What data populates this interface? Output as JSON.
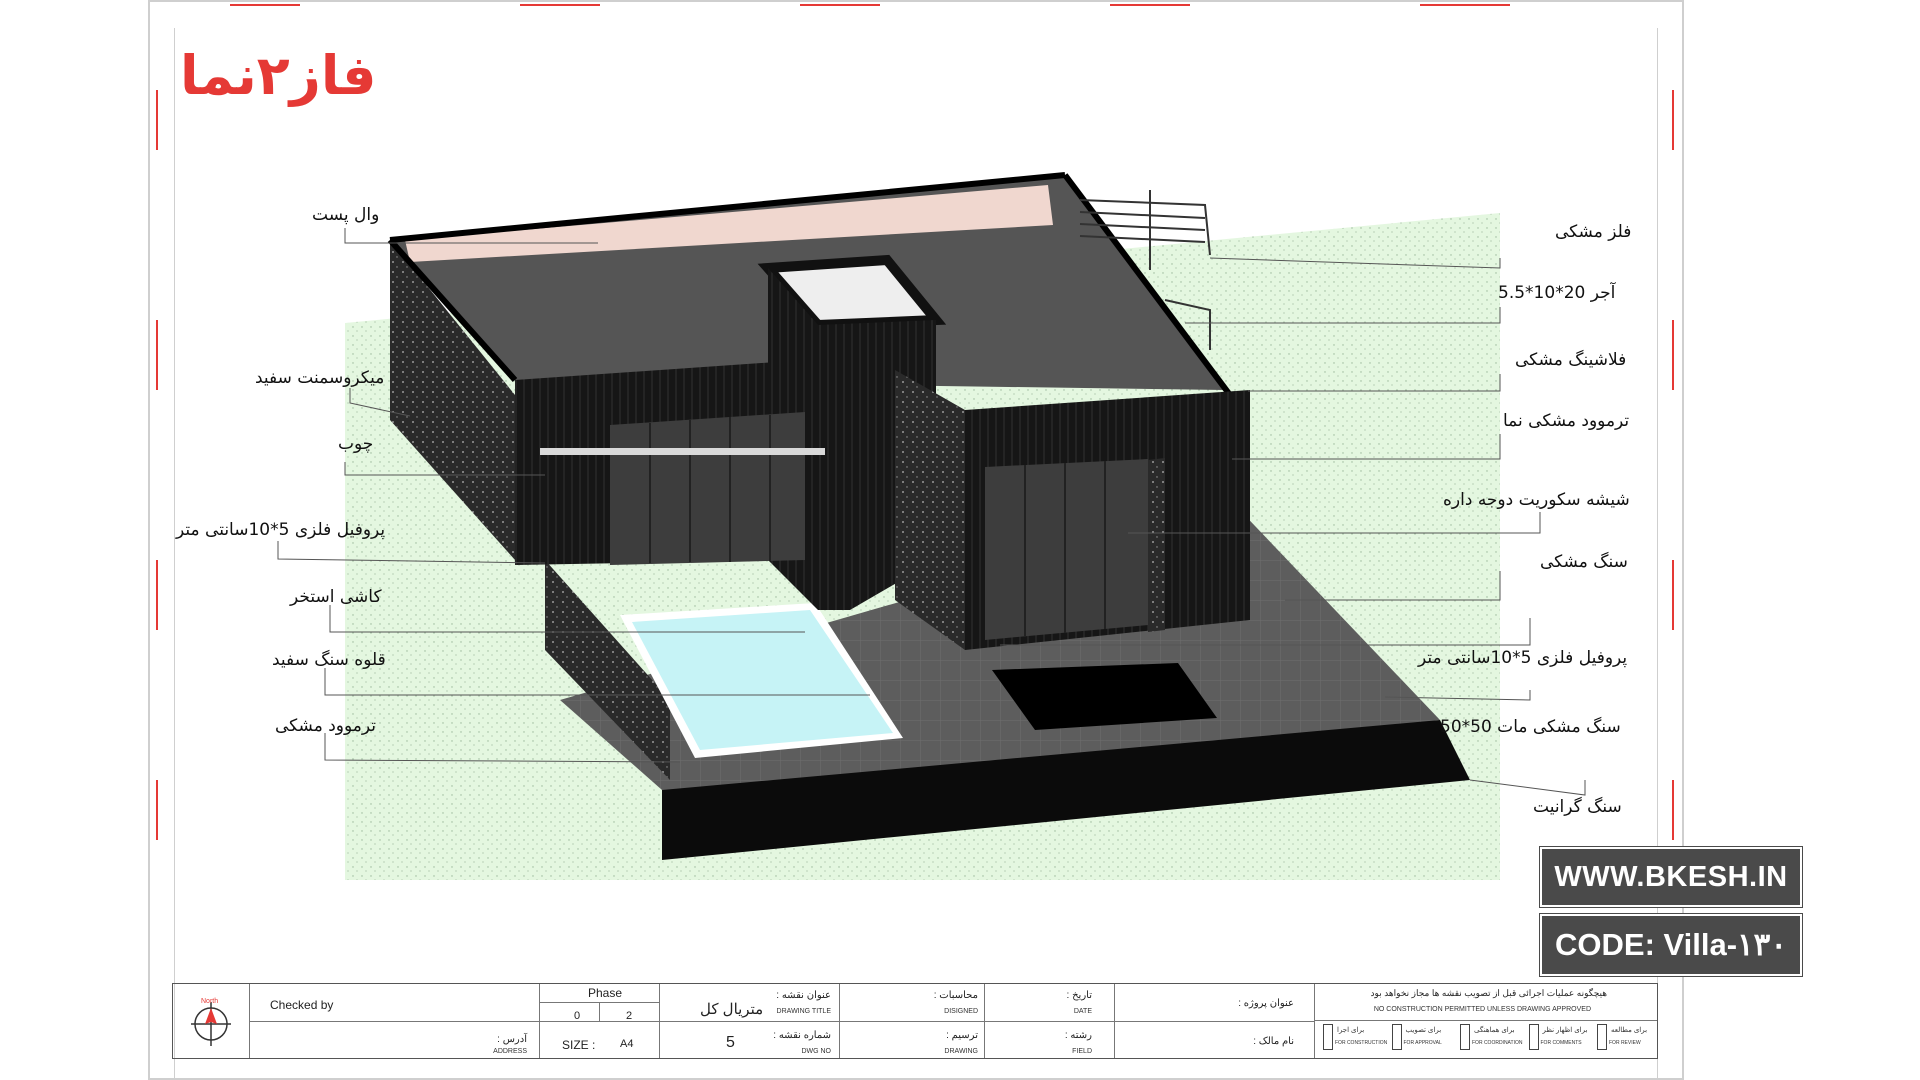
{
  "phase_title": "فاز۲نما",
  "labels_left": [
    {
      "key": "wall_post",
      "text": "وال پست"
    },
    {
      "key": "microcement",
      "text": "میکروسمنت سفید"
    },
    {
      "key": "wood",
      "text": "چوب"
    },
    {
      "key": "metal_profile_left",
      "text": "پروفیل فلزی 5*10سانتی متر"
    },
    {
      "key": "pool_tile",
      "text": "کاشی استخر"
    },
    {
      "key": "white_pebble",
      "text": "قلوه سنگ سفید"
    },
    {
      "key": "black_thermowood_left",
      "text": "ترموود مشکی"
    }
  ],
  "labels_right": [
    {
      "key": "black_metal",
      "text": "فلز مشکی"
    },
    {
      "key": "brick",
      "text": "آجر 20*10*5.5"
    },
    {
      "key": "black_flashing",
      "text": "فلاشینگ مشکی"
    },
    {
      "key": "black_thermowood_facade",
      "text": "ترموود مشکی نما"
    },
    {
      "key": "securit_glass",
      "text": "شیشه سکوریت دوجه داره"
    },
    {
      "key": "black_stone",
      "text": "سنگ مشکی"
    },
    {
      "key": "metal_profile_right",
      "text": "پروفیل فلزی 5*10سانتی متر"
    },
    {
      "key": "matte_black_stone",
      "text": "سنگ مشکی مات 50*50"
    },
    {
      "key": "granite",
      "text": "سنگ گرانیت"
    }
  ],
  "badges": {
    "website": "WWW.BKESH.IN",
    "code": "CODE:  Villa-۱۳۰"
  },
  "title_block": {
    "north": "North",
    "checked_by": "Checked by",
    "address_fa": "آدرس :",
    "address_en": "ADDRESS",
    "phase_label": "Phase",
    "phase_values": [
      "0",
      "2"
    ],
    "size_label": "SIZE :",
    "size_value": "A4",
    "drawing_title_value": "متریال کل",
    "drawing_title_fa": "عنوان نقشه :",
    "drawing_title_en": "DRAWING TITLE",
    "dwg_no_value": "5",
    "dwg_no_fa": "شماره نقشه :",
    "dwg_no_en": "DWG NO",
    "designed_fa": "محاسبات :",
    "designed_en": "DISIGNED",
    "drawing_fa": "ترسیم :",
    "drawing_en": "DRAWING",
    "date_fa": "تاریخ :",
    "date_en": "DATE",
    "field_fa": "رشته :",
    "field_en": "FIELD",
    "project_title_fa": "عنوان پروژه :",
    "owner_fa": "نام مالک :",
    "warning_fa": "هیچگونه عملیات اجرائی قبل از تصویب نقشه ها مجاز نخواهد بود",
    "warning_en": "NO CONSTRUCTION PERMITTED UNLESS DRAWING APPROVED",
    "checks": [
      {
        "fa": "برای اجرا",
        "en": "FOR CONSTRUCTION"
      },
      {
        "fa": "برای تصویب",
        "en": "FOR APPROVAL"
      },
      {
        "fa": "برای هماهنگی",
        "en": "FOR COORDINATION"
      },
      {
        "fa": "برای اظهار نظر",
        "en": "FOR COMMENTS"
      },
      {
        "fa": "برای مطالعه",
        "en": "FOR REVIEW"
      }
    ]
  }
}
